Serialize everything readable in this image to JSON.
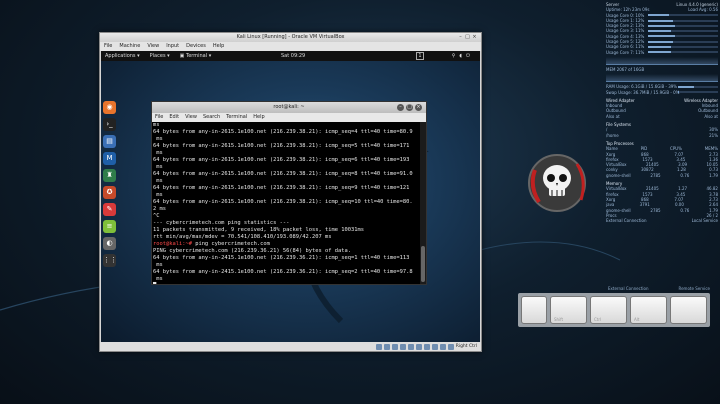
{
  "conky": {
    "header_left": "Server",
    "header_right": "Linux 4.4.0 (generic)",
    "uptime_label": "Uptime: 12h 23m 09s",
    "load_label": "Load Avg: 0.56",
    "cpus": [
      {
        "label": "Usage Core 0: 10%",
        "value": 10
      },
      {
        "label": "Usage Core 1: 12%",
        "value": 12
      },
      {
        "label": "Usage Core 2: 13%",
        "value": 13
      },
      {
        "label": "Usage Core 3: 11%",
        "value": 11
      },
      {
        "label": "Usage Core 4: 13%",
        "value": 13
      },
      {
        "label": "Usage Core 5: 12%",
        "value": 12
      },
      {
        "label": "Usage Core 6: 11%",
        "value": 11
      },
      {
        "label": "Usage Core 7: 11%",
        "value": 11
      }
    ],
    "mem_label": "MEM 2067 of 16GB",
    "ram_label": "RAM Usage: 6.1GiB / 15.6GiB - 39%",
    "swap_label": "Swap Usage: 36.7MiB / 15.9GiB - 0%",
    "net_left": "Wired Adapter",
    "net_right": "Wireless Adapter",
    "net_rows": [
      {
        "l": "Inbound",
        "r": "Inbound"
      },
      {
        "l": "Outbound",
        "r": "Outbound"
      },
      {
        "l": "Also at",
        "r": "Also at"
      }
    ],
    "file_sys": "File Systems",
    "fs_rows": [
      {
        "l": "/",
        "r": "30%"
      },
      {
        "l": "/home",
        "r": "21%"
      }
    ],
    "top_title": "Top Processes",
    "top_cols": [
      "Name",
      "PID",
      "CPU%",
      "MEM%"
    ],
    "top_rows": [
      [
        "Xorg",
        "868",
        "7.07",
        "2.73"
      ],
      [
        "firefox",
        "1573",
        "3.45",
        "1.36"
      ],
      [
        "VirtualBox",
        "21405",
        "3.09",
        "10.05"
      ],
      [
        "conky",
        "30872",
        "1.28",
        "0.73"
      ],
      [
        "gnome-shell",
        "2785",
        "0.76",
        "1.79"
      ]
    ],
    "mem_title": "Memory",
    "mem_rows": [
      [
        "VirtualBox",
        "21405",
        "1.27",
        "46.82"
      ],
      [
        "firefox",
        "1573",
        "3.45",
        "3.78"
      ],
      [
        "Xorg",
        "868",
        "7.07",
        "2.73"
      ],
      [
        "java",
        "3791",
        "0.00",
        "2.64"
      ],
      [
        "gnome-shell",
        "2785",
        "0.76",
        "1.79"
      ]
    ],
    "procs_label": "Procs",
    "procs_value": "26 / 2",
    "ext_conn_left": "External Connection",
    "ext_conn_right": "Local Service"
  },
  "right_panel": {
    "remote_left": "External Connection",
    "remote_right": "Remote Service"
  },
  "keys": [
    "",
    "Shift",
    "Ctrl",
    "Alt",
    ""
  ],
  "vbox": {
    "title": "Kali Linux [Running] - Oracle VM VirtualBox",
    "menu": [
      "File",
      "Machine",
      "View",
      "Input",
      "Devices",
      "Help"
    ],
    "status_right": "Right Ctrl"
  },
  "kali": {
    "top_menu": [
      "Applications ▾",
      "Places ▾"
    ],
    "terminal_menu": "Terminal ▾",
    "clock": "Sat 09:29",
    "workspace": "1"
  },
  "terminal": {
    "title": "root@kali: ~",
    "menu": [
      "File",
      "Edit",
      "View",
      "Search",
      "Terminal",
      "Help"
    ],
    "lines": [
      {
        "t": "ms"
      },
      {
        "t": "64 bytes from any-in-2615.1e100.net (216.239.38.21): icmp_seq=4 ttl=40 time=80.9"
      },
      {
        "t": " ms"
      },
      {
        "t": "64 bytes from any-in-2615.1e100.net (216.239.38.21): icmp_seq=5 ttl=40 time=171"
      },
      {
        "t": " ms"
      },
      {
        "t": "64 bytes from any-in-2615.1e100.net (216.239.38.21): icmp_seq=6 ttl=40 time=193"
      },
      {
        "t": " ms"
      },
      {
        "t": "64 bytes from any-in-2615.1e100.net (216.239.38.21): icmp_seq=8 ttl=40 time=91.0"
      },
      {
        "t": " ms"
      },
      {
        "t": "64 bytes from any-in-2615.1e100.net (216.239.38.21): icmp_seq=9 ttl=40 time=121"
      },
      {
        "t": " ms"
      },
      {
        "t": "64 bytes from any-in-2615.1e100.net (216.239.38.21): icmp_seq=10 ttl=40 time=80."
      },
      {
        "t": "2 ms"
      },
      {
        "t": "^C"
      },
      {
        "t": "--- cybercrimetech.com ping statistics ---"
      },
      {
        "t": "11 packets transmitted, 9 received, 18% packet loss, time 10031ms"
      },
      {
        "t": "rtt min/avg/max/mdev = 70.541/108.410/193.089/42.207 ms"
      },
      {
        "p": "root@kali:~#",
        "t": " ping cybercrimetech.com"
      },
      {
        "t": "PING cybercrimetech.com (216.239.36.21) 56(84) bytes of data."
      },
      {
        "t": "64 bytes from any-in-2415.1e100.net (216.239.36.21): icmp_seq=1 ttl=40 time=113"
      },
      {
        "t": " ms"
      },
      {
        "t": "64 bytes from any-in-2415.1e100.net (216.239.36.21): icmp_seq=2 ttl=40 time=97.8"
      },
      {
        "t": " ms"
      },
      {
        "t": "█"
      }
    ]
  }
}
